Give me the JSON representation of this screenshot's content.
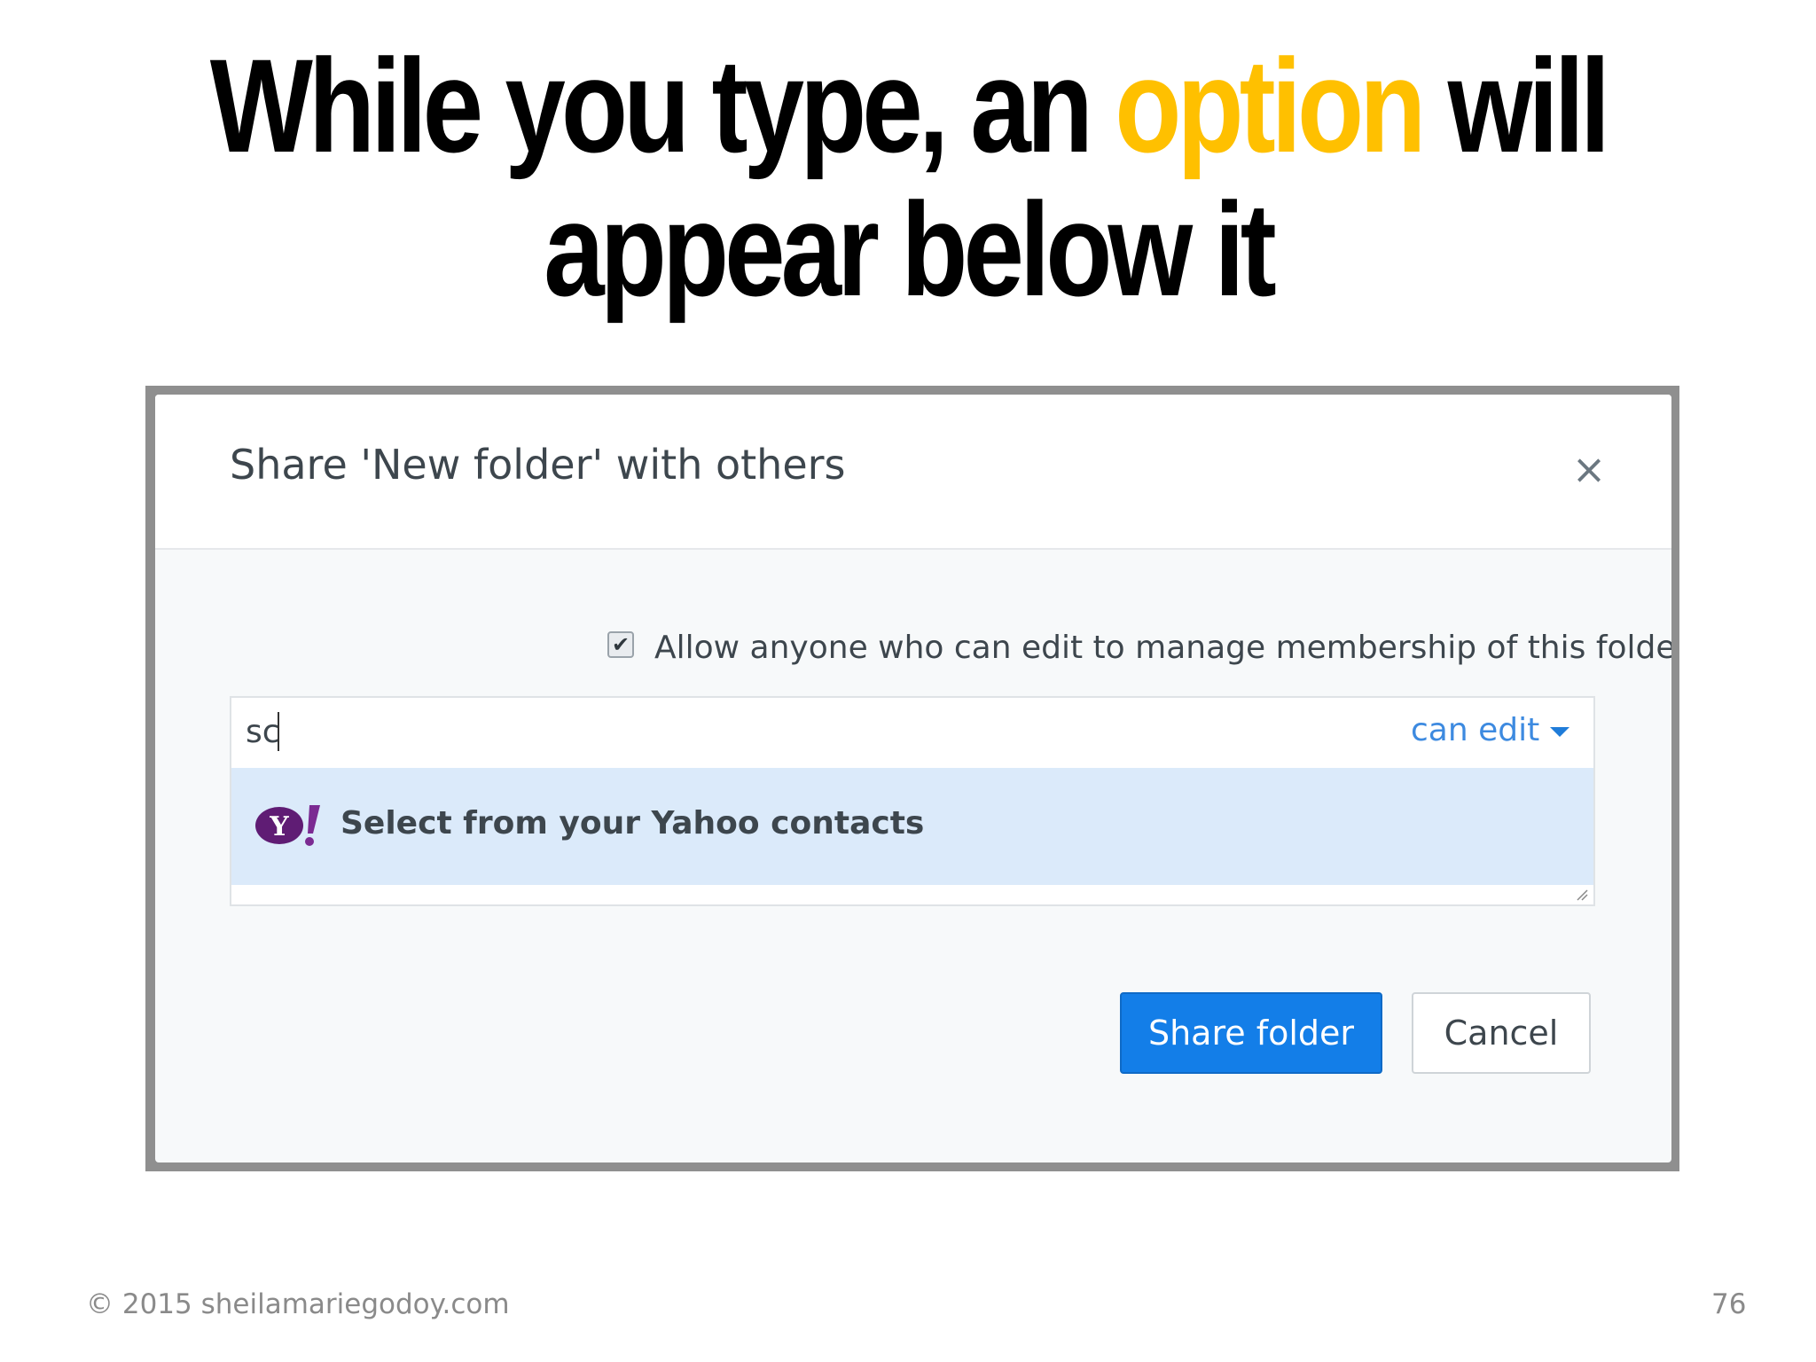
{
  "slide": {
    "headline_part1": "While you type, an ",
    "headline_highlight": "option",
    "headline_part2": " will",
    "headline_line2": "appear below it",
    "highlight_color": "#FFC000",
    "footer_copyright": "© 2015 sheilamariegodoy.com",
    "page_number": "76"
  },
  "dialog": {
    "title": "Share 'New folder' with others",
    "close_glyph": "×",
    "checkbox_checked": true,
    "checkbox_label": "Allow anyone who can edit to manage membership of this folder",
    "input_value": "sc",
    "permission_label": "can edit",
    "suggestion_label": "Select from your Yahoo contacts",
    "suggestion_icon": "yahoo-logo-icon",
    "share_button": "Share folder",
    "cancel_button": "Cancel",
    "accent_color": "#137ee8",
    "suggestion_bg": "#dbeafa"
  }
}
